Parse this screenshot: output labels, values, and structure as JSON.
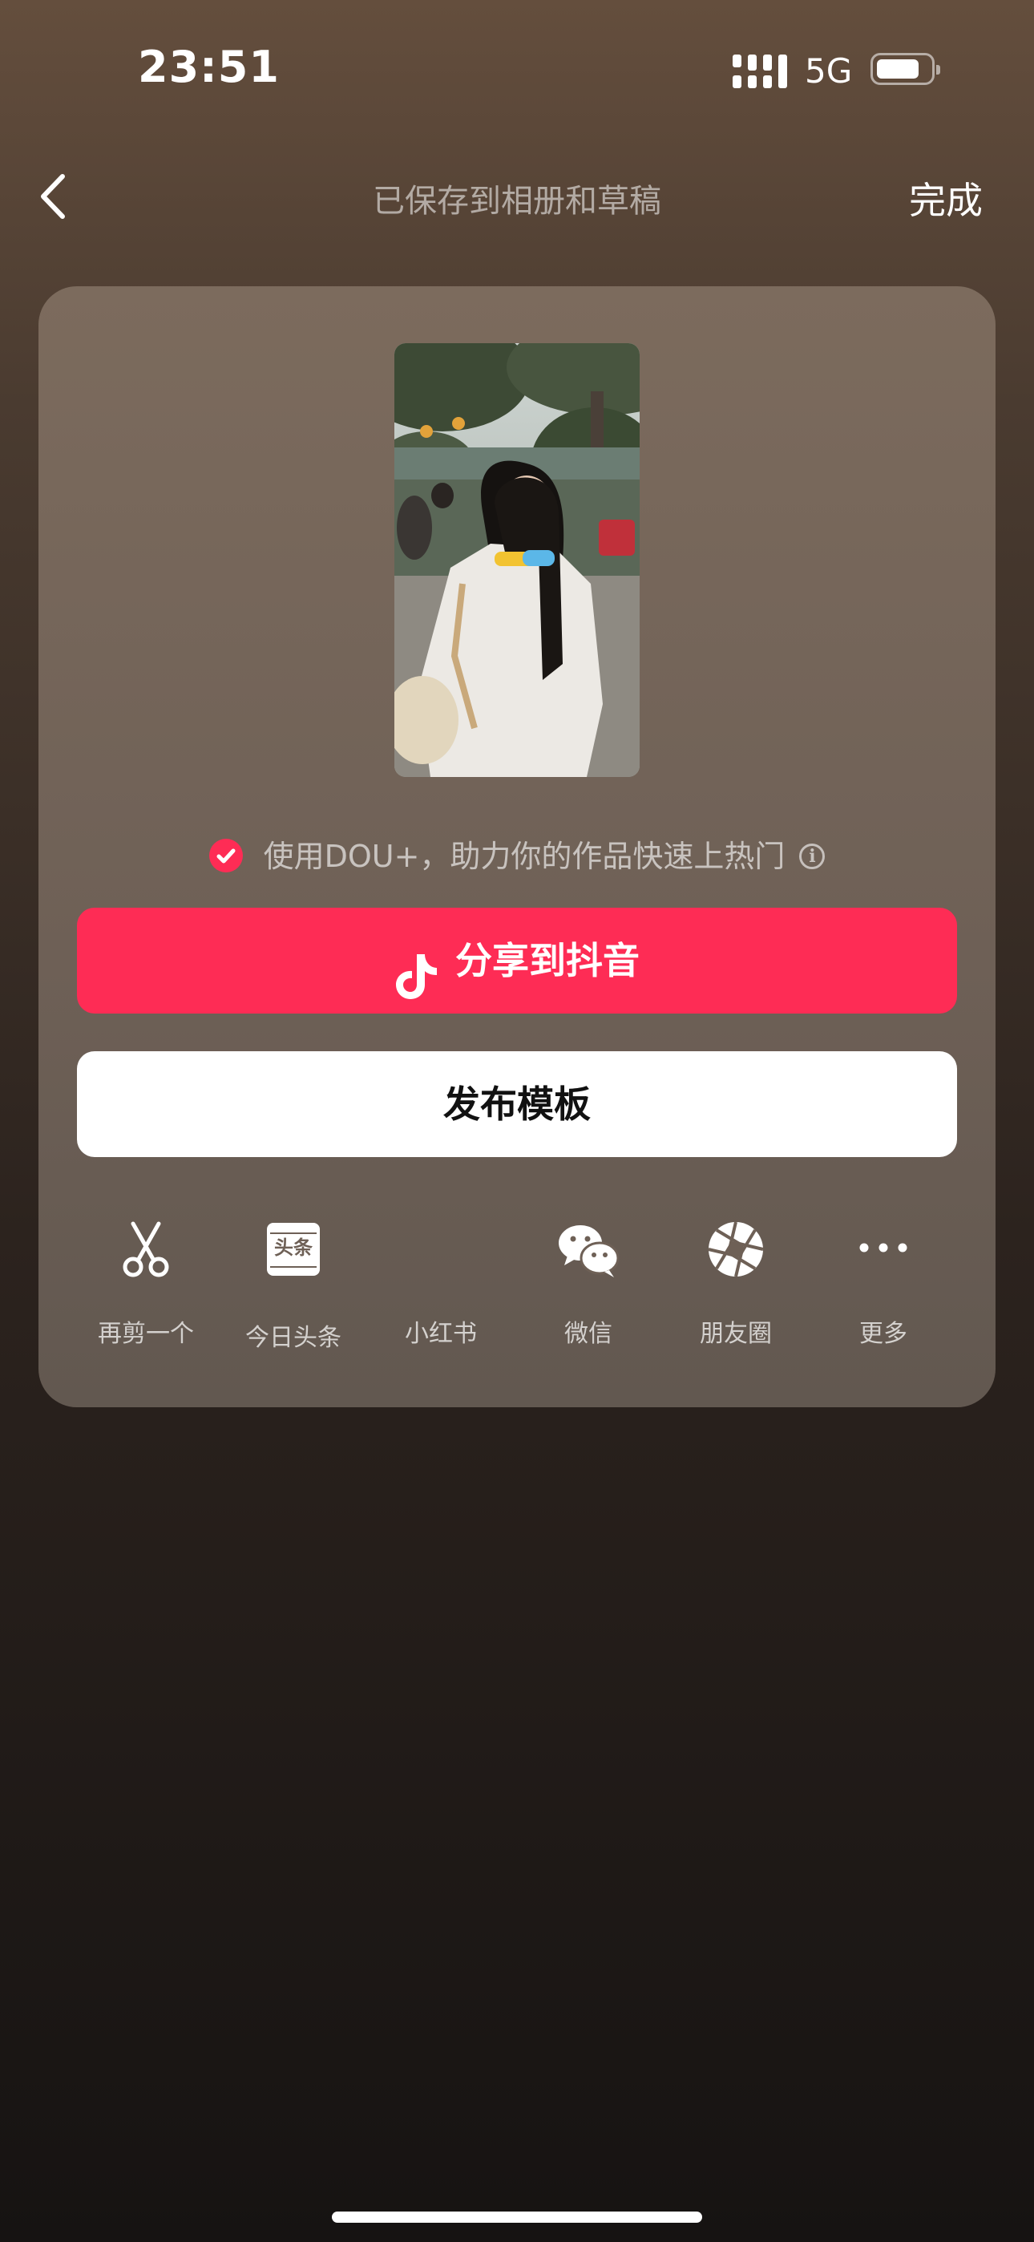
{
  "status_bar": {
    "time": "23:51",
    "network": "5G"
  },
  "nav": {
    "title": "已保存到相册和草稿",
    "done_label": "完成"
  },
  "dou_promo": {
    "text": "使用DOU+，助力你的作品快速上热门"
  },
  "buttons": {
    "share_label": "分享到抖音",
    "template_label": "发布模板"
  },
  "actions": [
    {
      "label": "再剪一个",
      "icon": "scissors-icon"
    },
    {
      "label": "今日头条",
      "icon": "toutiao-icon",
      "icon_text": "头条"
    },
    {
      "label": "小红书",
      "icon": "xiaohongshu-icon"
    },
    {
      "label": "微信",
      "icon": "wechat-icon"
    },
    {
      "label": "朋友圈",
      "icon": "moments-icon"
    },
    {
      "label": "更多",
      "icon": "more-icon"
    }
  ],
  "colors": {
    "accent": "#fe2c55",
    "card": "#75665a"
  }
}
